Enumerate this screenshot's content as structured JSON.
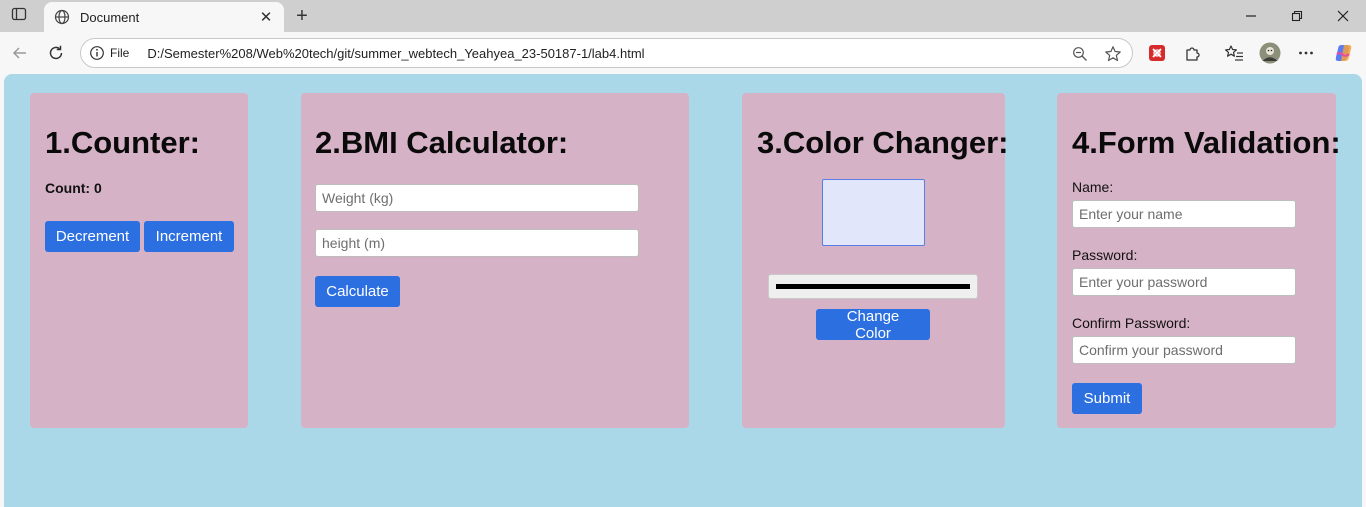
{
  "browser": {
    "tab_title": "Document",
    "address_scheme": "File",
    "url": "D:/Semester%208/Web%20tech/git/summer_webtech_Yeahyea_23-50187-1/lab4.html"
  },
  "counter": {
    "title": "1.Counter:",
    "count_text": "Count: 0",
    "decrement_label": "Decrement",
    "increment_label": "Increment"
  },
  "bmi": {
    "title": "2.BMI Calculator:",
    "weight_placeholder": "Weight (kg)",
    "height_placeholder": "height (m)",
    "calculate_label": "Calculate"
  },
  "color_changer": {
    "title": "3.Color Changer:",
    "preview_color": "#e1e6fa",
    "picker_color": "#000000",
    "button_label": "Change Color"
  },
  "form": {
    "title": "4.Form Validation:",
    "name_label": "Name:",
    "name_placeholder": "Enter your name",
    "password_label": "Password:",
    "password_placeholder": "Enter your password",
    "confirm_label": "Confirm Password:",
    "confirm_placeholder": "Confirm your password",
    "submit_label": "Submit"
  },
  "colors": {
    "page_background": "#abd8e9",
    "card_background": "#d6b2c6",
    "button_blue": "#2b6fe0"
  }
}
